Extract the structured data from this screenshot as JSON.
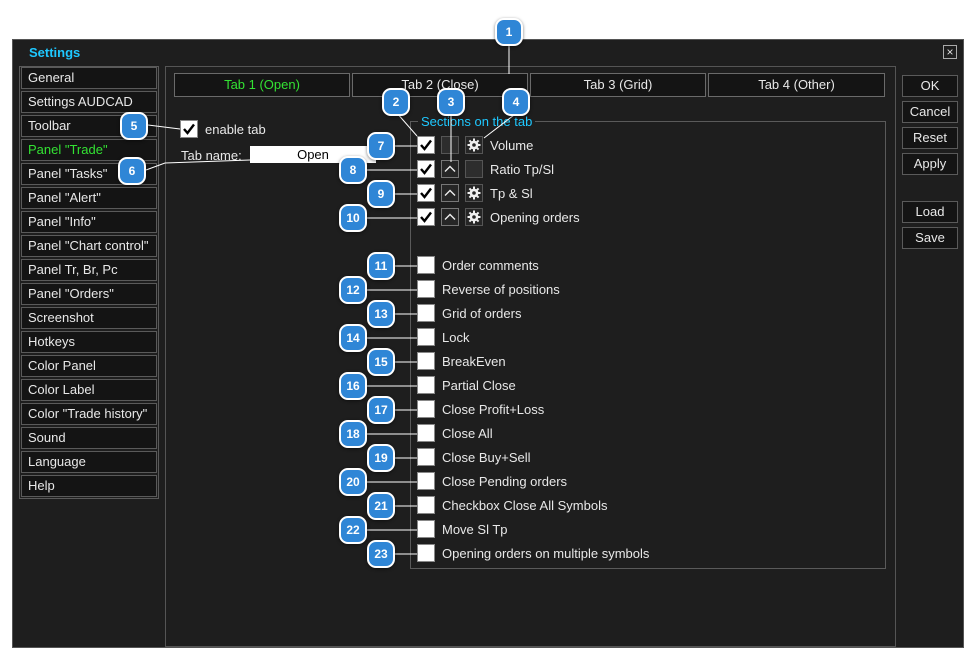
{
  "window": {
    "title": "Settings",
    "close_label": "×"
  },
  "sidebar": {
    "items": [
      {
        "label": "General"
      },
      {
        "label": "Settings AUDCAD"
      },
      {
        "label": "Toolbar"
      },
      {
        "label": "Panel \"Trade\"",
        "active": true
      },
      {
        "label": "Panel \"Tasks\""
      },
      {
        "label": "Panel \"Alert\""
      },
      {
        "label": "Panel \"Info\""
      },
      {
        "label": "Panel \"Chart control\""
      },
      {
        "label": "Panel Tr, Br, Pc"
      },
      {
        "label": "Panel \"Orders\""
      },
      {
        "label": "Screenshot"
      },
      {
        "label": "Hotkeys"
      },
      {
        "label": "Color Panel"
      },
      {
        "label": "Color Label"
      },
      {
        "label": "Color \"Trade history\""
      },
      {
        "label": "Sound"
      },
      {
        "label": "Language"
      },
      {
        "label": "Help"
      }
    ]
  },
  "tabs": [
    {
      "label": "Tab 1 (Open)",
      "active": true
    },
    {
      "label": "Tab 2 (Close)"
    },
    {
      "label": "Tab 3 (Grid)"
    },
    {
      "label": "Tab 4 (Other)"
    }
  ],
  "buttons": {
    "ok": "OK",
    "cancel": "Cancel",
    "reset": "Reset",
    "apply": "Apply",
    "load": "Load",
    "save": "Save"
  },
  "tab_settings": {
    "enable_tab_label": "enable tab",
    "enable_tab_checked": true,
    "tab_name_label": "Tab name:",
    "tab_name_value": "Open"
  },
  "sections": {
    "title": "Sections on the tab",
    "rows_with_controls": [
      {
        "label": "Volume",
        "checked": true,
        "control": "square"
      },
      {
        "label": "Ratio Tp/Sl",
        "checked": true,
        "control": "arrow"
      },
      {
        "label": "Tp & Sl",
        "checked": true,
        "control": "arrow"
      },
      {
        "label": "Opening orders",
        "checked": true,
        "control": "arrow"
      }
    ],
    "options": [
      {
        "label": "Order comments",
        "checked": false
      },
      {
        "label": "Reverse of positions",
        "checked": false
      },
      {
        "label": "Grid of orders",
        "checked": false
      },
      {
        "label": "Lock",
        "checked": false
      },
      {
        "label": "BreakEven",
        "checked": false
      },
      {
        "label": "Partial Close",
        "checked": false
      },
      {
        "label": "Close Profit+Loss",
        "checked": false
      },
      {
        "label": "Close All",
        "checked": false
      },
      {
        "label": "Close Buy+Sell",
        "checked": false
      },
      {
        "label": "Close Pending orders",
        "checked": false
      },
      {
        "label": "Checkbox Close All Symbols",
        "checked": false
      },
      {
        "label": "Move Sl Tp",
        "checked": false
      },
      {
        "label": "Opening orders on multiple symbols",
        "checked": false
      }
    ]
  },
  "callouts": [
    "1",
    "2",
    "3",
    "4",
    "5",
    "6",
    "7",
    "8",
    "9",
    "10",
    "11",
    "12",
    "13",
    "14",
    "15",
    "16",
    "17",
    "18",
    "19",
    "20",
    "21",
    "22",
    "23"
  ],
  "colors": {
    "accent": "#1ec8ff",
    "active_green": "#33e233",
    "badge": "#2f86d6",
    "window_bg": "#1e1e1e"
  }
}
